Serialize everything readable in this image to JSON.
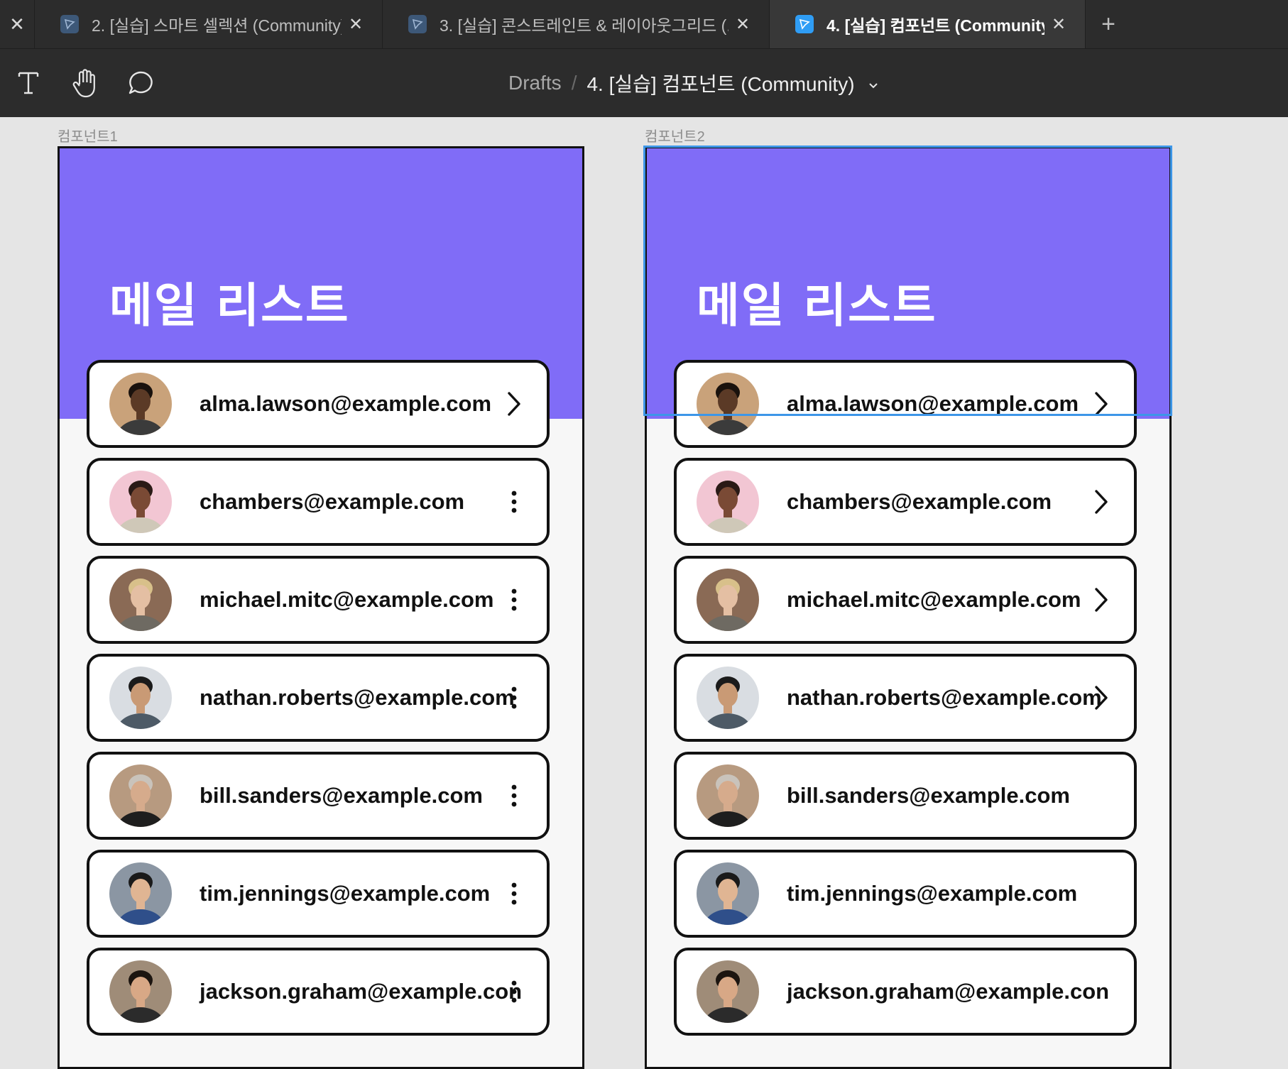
{
  "tabs": [
    {
      "label": "2. [실습] 스마트 셀렉션 (Community)",
      "active": false
    },
    {
      "label": "3. [실습] 콘스트레인트 & 레이아웃그리드 (...",
      "active": false
    },
    {
      "label": "4. [실습] 컴포넌트 (Community)",
      "active": true
    }
  ],
  "toolbar": {
    "tools": [
      "text-tool-icon",
      "hand-tool-icon",
      "comment-tool-icon"
    ]
  },
  "breadcrumb": {
    "root": "Drafts",
    "separator": "/",
    "file": "4. [실습] 컴포넌트 (Community)"
  },
  "frames": [
    {
      "label": "컴포넌트1",
      "title": "메일 리스트",
      "first_action": "chevron-right-icon",
      "other_action": "more-vertical-icon",
      "last_actions_visible": true
    },
    {
      "label": "컴포넌트2",
      "title": "메일 리스트",
      "first_action": "chevron-right-icon",
      "other_action": "chevron-right-icon",
      "last_actions_visible": false
    }
  ],
  "emails": [
    "alma.lawson@example.com",
    "chambers@example.com",
    "michael.mitc@example.com",
    "nathan.roberts@example.com",
    "bill.sanders@example.com",
    "tim.jennings@example.com",
    "jackson.graham@example.con"
  ],
  "colors": {
    "header_purple": "#806cf7",
    "selection_blue": "#3d96e8",
    "toolbar_bg": "#2c2c2c",
    "canvas_bg": "#e5e5e5"
  }
}
